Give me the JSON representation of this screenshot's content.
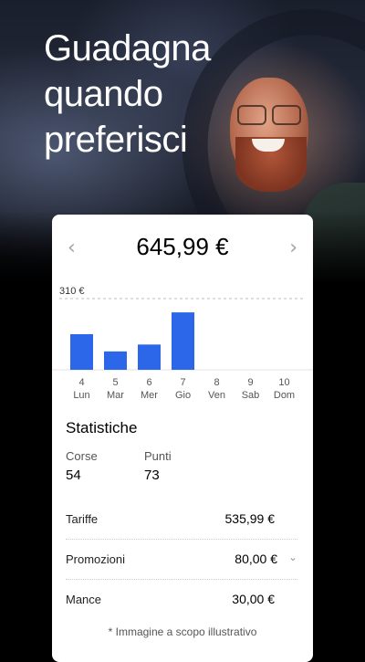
{
  "headline": [
    "Guadagna",
    "quando",
    "preferisci"
  ],
  "card": {
    "prev_arrow": "‹",
    "next_arrow": "›",
    "total": "645,99 €",
    "stats_title": "Statistiche",
    "stats": [
      {
        "label": "Corse",
        "value": "54"
      },
      {
        "label": "Punti",
        "value": "73"
      }
    ],
    "rows": [
      {
        "label": "Tariffe",
        "value": "535,99 €"
      },
      {
        "label": "Promozioni",
        "value": "80,00 €",
        "chevron": "⌄"
      },
      {
        "label": "Mance",
        "value": "30,00 €"
      }
    ],
    "disclaimer": "* Immagine a scopo illustrativo"
  },
  "icons": {
    "prev": "chevron-left-icon",
    "next": "chevron-right-icon",
    "expand": "chevron-down-icon"
  },
  "colors": {
    "bar": "#2c67ea",
    "card_bg": "#ffffff",
    "background": "#000000",
    "headline": "#ffffff"
  },
  "chart_data": {
    "type": "bar",
    "categories": [
      "4",
      "5",
      "6",
      "7",
      "8",
      "9",
      "10"
    ],
    "day_labels": [
      "Lun",
      "Mar",
      "Mer",
      "Gio",
      "Ven",
      "Sab",
      "Dom"
    ],
    "values": [
      155,
      80,
      110,
      250,
      0,
      0,
      0
    ],
    "reference_label": "310 €",
    "reference_value": 310,
    "ylim": [
      0,
      310
    ],
    "grid": false
  }
}
